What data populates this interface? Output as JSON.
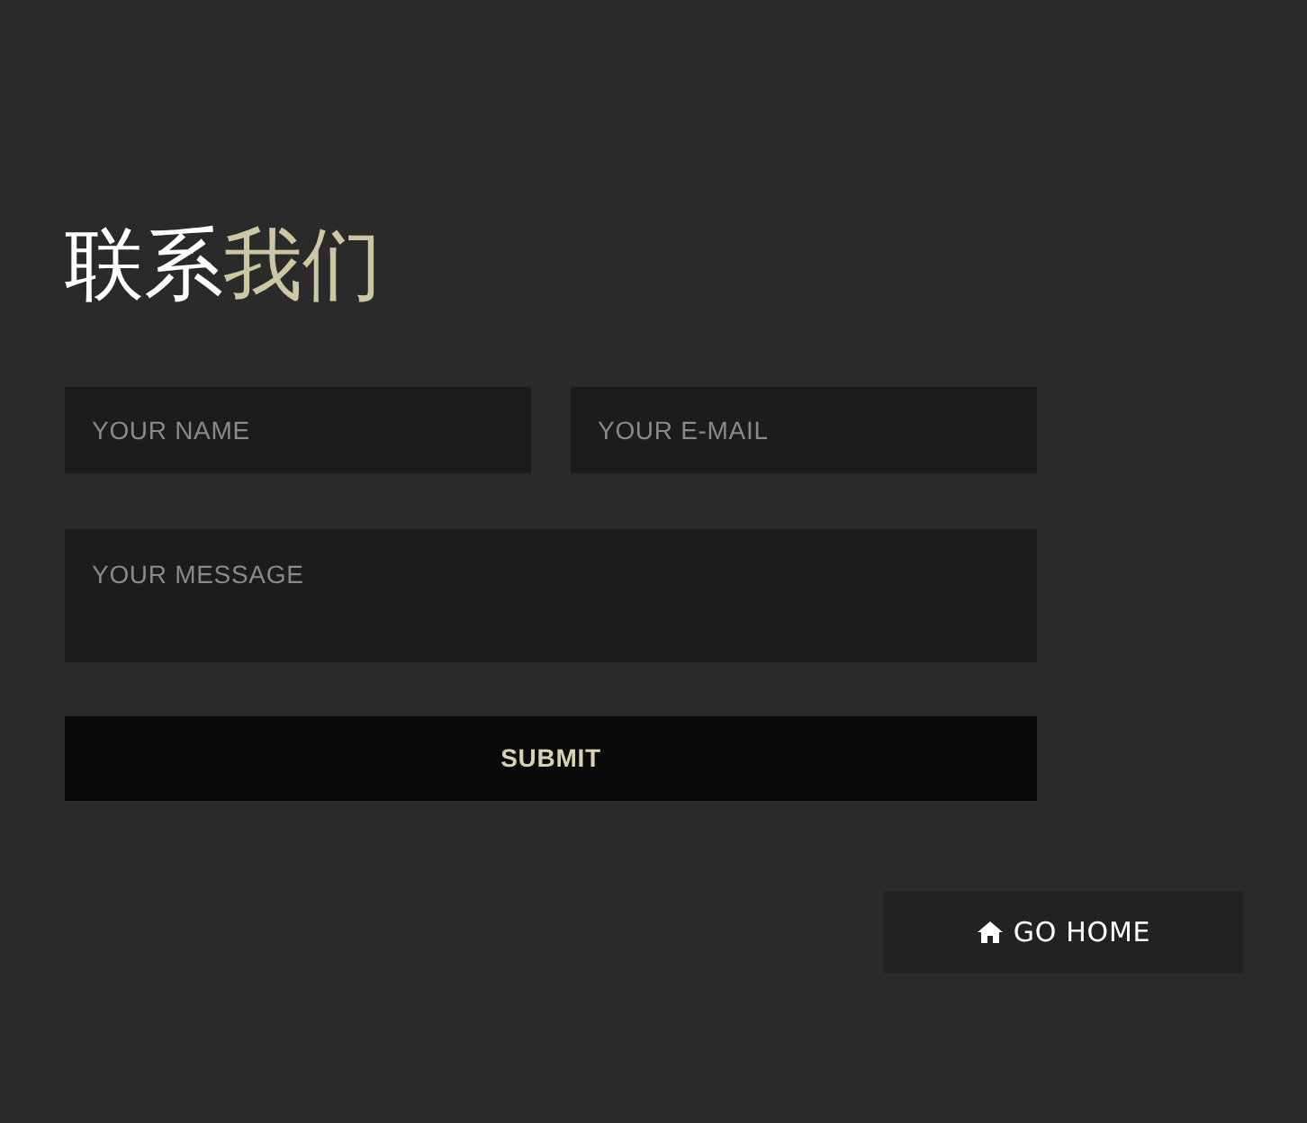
{
  "heading": [
    {
      "text": "联系",
      "accent": false
    },
    {
      "text": "我们",
      "accent": true
    }
  ],
  "form": {
    "name_field": {
      "placeholder": "YOUR NAME"
    },
    "email_field": {
      "placeholder": "YOUR E-MAIL"
    },
    "message_field": {
      "placeholder": "YOUR MESSAGE"
    },
    "submit": "SUBMIT"
  },
  "home_button": "GO HOME"
}
